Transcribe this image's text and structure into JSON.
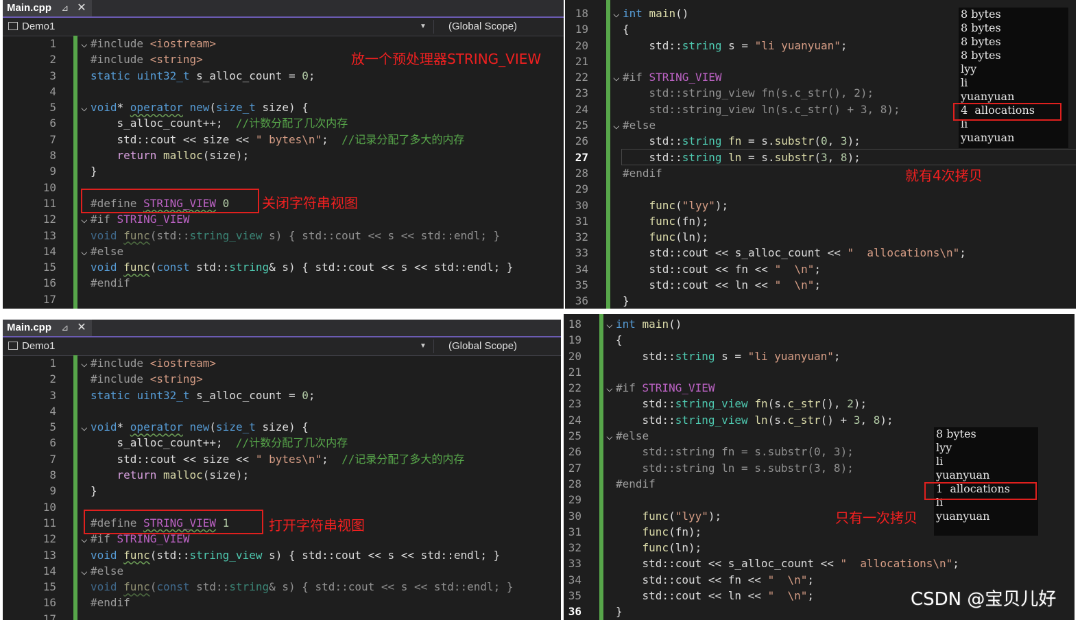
{
  "top_left": {
    "tab": {
      "title": "Main.cpp",
      "pin": "⊿",
      "close": "✕"
    },
    "nav": {
      "project": "Demo1",
      "scope": "(Global Scope)"
    },
    "line_numbers": [
      "1",
      "2",
      "3",
      "4",
      "5",
      "6",
      "7",
      "8",
      "9",
      "10",
      "11",
      "12",
      "13",
      "14",
      "15",
      "16",
      "17"
    ],
    "annotation_title": "放一个预处理器STRING_VIEW",
    "annotation_define": "关闭字符串视图",
    "define_value": "0"
  },
  "bottom_left": {
    "tab": {
      "title": "Main.cpp",
      "pin": "⊿",
      "close": "✕"
    },
    "nav": {
      "project": "Demo1",
      "scope": "(Global Scope)"
    },
    "line_numbers": [
      "1",
      "2",
      "3",
      "4",
      "5",
      "6",
      "7",
      "8",
      "9",
      "10",
      "11",
      "12",
      "13",
      "14",
      "15",
      "16",
      "17"
    ],
    "annotation_define": "打开字符串视图",
    "define_value": "1"
  },
  "code_left": {
    "l1": [
      "#include ",
      "<iostream>"
    ],
    "l2": [
      "#include ",
      "<string>"
    ],
    "l3": [
      "static ",
      "uint32_t",
      " s_alloc_count = ",
      "0",
      ";"
    ],
    "l5": [
      "void",
      "* ",
      "operator",
      " ",
      "new",
      "(",
      "size_t",
      " size) {"
    ],
    "l6": [
      "s_alloc_count++;  ",
      "//计数分配了几次内存"
    ],
    "l7": [
      "std::cout << size << ",
      "\" bytes\\n\"",
      ";  ",
      "//记录分配了多大的内存"
    ],
    "l8": [
      "return",
      " ",
      "malloc",
      "(size);"
    ],
    "l9": "}",
    "l11": [
      "#define ",
      "STRING_VIEW"
    ],
    "l12": [
      "#if ",
      "STRING_VIEW"
    ],
    "l13": [
      "void",
      " ",
      "func",
      "(std::",
      "string_view",
      " s) { std::cout << s << std::endl; }"
    ],
    "l14": "#else",
    "l15": [
      "void",
      " ",
      "func",
      "(",
      "const",
      " std::",
      "string",
      "& s) { std::cout << s << std::endl; }"
    ],
    "l16": "#endif"
  },
  "top_right": {
    "line_numbers": [
      "18",
      "19",
      "20",
      "21",
      "22",
      "23",
      "24",
      "25",
      "26",
      "27",
      "28",
      "29",
      "30",
      "31",
      "32",
      "33",
      "34",
      "35",
      "36"
    ],
    "current_line": "27",
    "console": [
      "8 bytes",
      "8 bytes",
      "8 bytes",
      "8 bytes",
      "lyy",
      "li",
      "yuanyuan",
      "4  allocations",
      "li",
      "yuanyuan"
    ],
    "annotation": "就有4次拷贝"
  },
  "bottom_right": {
    "line_numbers": [
      "18",
      "19",
      "20",
      "21",
      "22",
      "23",
      "24",
      "25",
      "26",
      "27",
      "28",
      "29",
      "30",
      "31",
      "32",
      "33",
      "34",
      "35",
      "36"
    ],
    "current_line": "36",
    "console": [
      "8 bytes",
      "lyy",
      "li",
      "yuanyuan",
      "1  allocations",
      "li",
      "yuanyuan"
    ],
    "annotation": "只有一次拷贝"
  },
  "code_right": {
    "l18": [
      "int",
      " ",
      "main",
      "()"
    ],
    "l19": "{",
    "l20": [
      "std::",
      "string",
      " s = ",
      "\"li yuanyuan\"",
      ";"
    ],
    "l22": [
      "#if ",
      "STRING_VIEW"
    ],
    "l23": [
      "std::",
      "string_view",
      " ",
      "fn",
      "(s.",
      "c_str",
      "(), ",
      "2",
      ");"
    ],
    "l24": [
      "std::",
      "string_view",
      " ",
      "ln",
      "(s.",
      "c_str",
      "() + ",
      "3",
      ", ",
      "8",
      ");"
    ],
    "l25": "#else",
    "l26": [
      "std::",
      "string",
      " ",
      "fn",
      " = s.",
      "substr",
      "(",
      "0",
      ", ",
      "3",
      ");"
    ],
    "l27": [
      "std::",
      "string",
      " ",
      "ln",
      " = s.",
      "substr",
      "(",
      "3",
      ", ",
      "8",
      ");"
    ],
    "l28": "#endif",
    "l30": [
      "func",
      "(",
      "\"lyy\"",
      ");"
    ],
    "l31": [
      "func",
      "(fn);"
    ],
    "l32": [
      "func",
      "(ln);"
    ],
    "l33": [
      "std::cout << s_alloc_count << ",
      "\"  allocations\\n\"",
      ";"
    ],
    "l34": [
      "std::cout << fn << ",
      "\"  \\n\"",
      ";"
    ],
    "l35": [
      "std::cout << ln << ",
      "\"  \\n\"",
      ";"
    ],
    "l36": "}"
  },
  "watermark": "CSDN @宝贝儿好"
}
